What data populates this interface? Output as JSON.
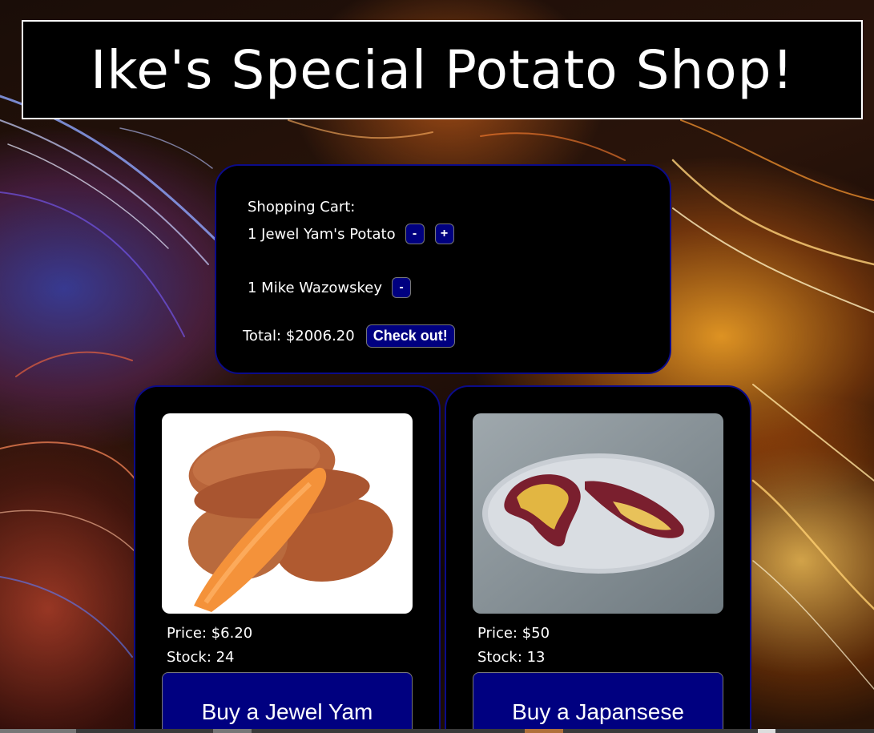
{
  "header": {
    "title": "Ike's Special Potato Shop!"
  },
  "cart": {
    "title": "Shopping Cart:",
    "items": [
      {
        "label": "1 Jewel Yam's Potato",
        "minus_label": "-",
        "plus_label": "+"
      },
      {
        "label": "1 Mike Wazowskey",
        "minus_label": "-"
      }
    ],
    "total_label": "Total: $2006.20",
    "checkout_label": "Check out!"
  },
  "products": [
    {
      "image_icon": "jewel-yam-photo",
      "price": "Price: $6.20",
      "stock": "Stock: 24",
      "buy_label": "Buy a Jewel Yam"
    },
    {
      "image_icon": "japanese-sweet-potato-photo",
      "price": "Price: $50",
      "stock": "Stock: 13",
      "buy_label": "Buy a Japansese"
    }
  ],
  "colors": {
    "button_bg": "#000080",
    "card_border": "#0b0b8a",
    "panel_bg": "#000000",
    "text": "#ffffff"
  }
}
